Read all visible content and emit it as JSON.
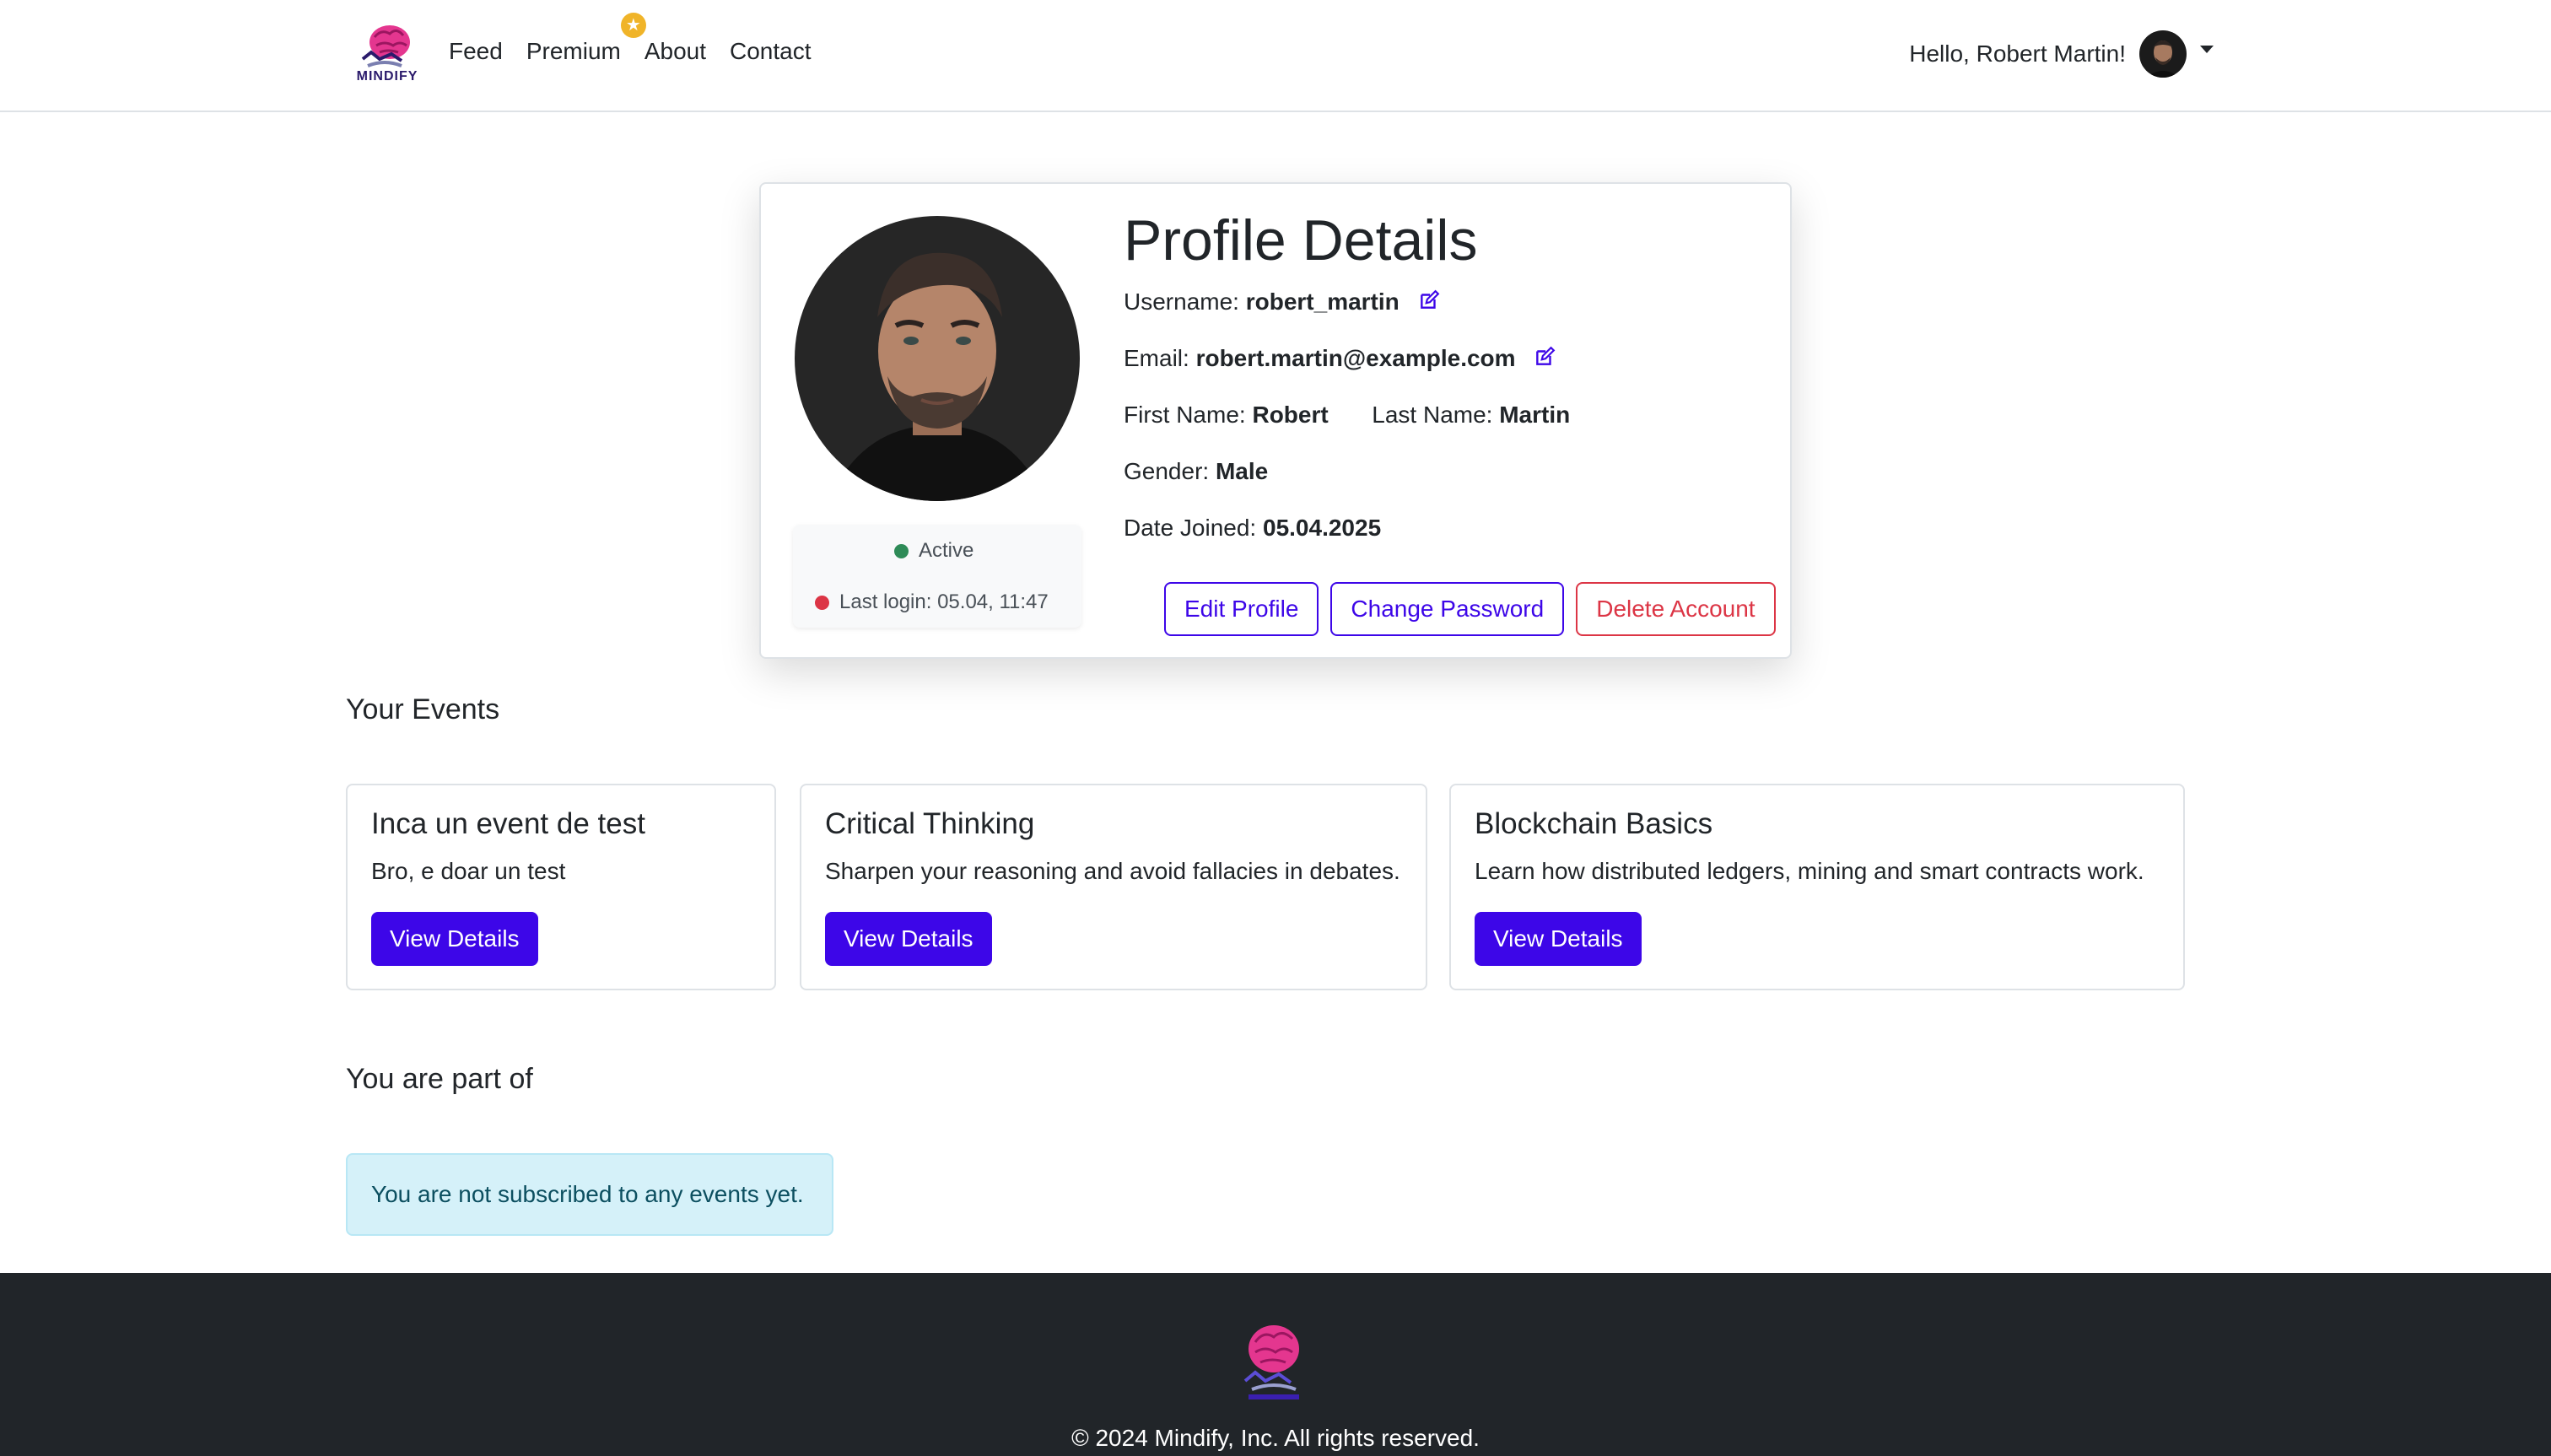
{
  "nav": {
    "brand": "MINDIFY",
    "links": [
      "Feed",
      "Premium",
      "About",
      "Contact"
    ],
    "greeting": "Hello, Robert Martin!"
  },
  "profile": {
    "title": "Profile Details",
    "username_label": "Username:",
    "username": "robert_martin",
    "email_label": "Email:",
    "email": "robert.martin@example.com",
    "first_name_label": "First Name:",
    "first_name": "Robert",
    "last_name_label": "Last Name:",
    "last_name": "Martin",
    "gender_label": "Gender:",
    "gender": "Male",
    "date_joined_label": "Date Joined:",
    "date_joined": "05.04.2025",
    "status": "Active",
    "last_login": "Last login: 05.04, 11:47",
    "buttons": {
      "edit": "Edit Profile",
      "change_password": "Change Password",
      "delete": "Delete Account"
    }
  },
  "events_section": {
    "title": "Your Events",
    "events": [
      {
        "title": "Inca un event de test",
        "description": "Bro, e doar un test",
        "button": "View Details"
      },
      {
        "title": "Critical Thinking",
        "description": "Sharpen your reasoning and avoid fallacies in debates.",
        "button": "View Details"
      },
      {
        "title": "Blockchain Basics",
        "description": "Learn how distributed ledgers, mining and smart contracts work.",
        "button": "View Details"
      }
    ]
  },
  "part_of_section": {
    "title": "You are part of",
    "empty_message": "You are not subscribed to any events yet."
  },
  "footer": {
    "copyright": "© 2024 Mindify, Inc. All rights reserved."
  },
  "colors": {
    "primary": "#3d06e8",
    "danger": "#dc3545",
    "success": "#2e8b57",
    "footer_bg": "#212529",
    "info_bg": "#d5f1f9"
  },
  "icons": [
    "brain-logo-icon",
    "star-icon",
    "edit-icon",
    "caret-down-icon"
  ]
}
